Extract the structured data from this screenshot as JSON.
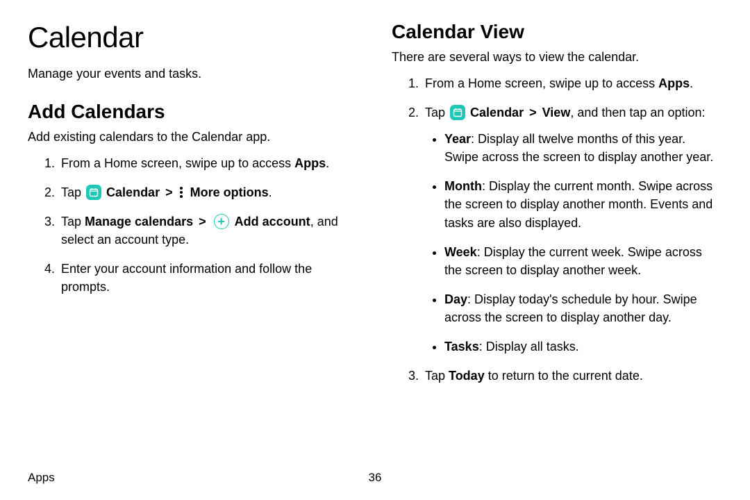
{
  "left": {
    "title": "Calendar",
    "subtitle": "Manage your events and tasks.",
    "section_heading": "Add Calendars",
    "section_intro": "Add existing calendars to the Calendar app.",
    "steps": {
      "s1_a": "From a Home screen, swipe up to access ",
      "s1_b": "Apps",
      "s1_c": ".",
      "s2_a": "Tap ",
      "s2_b": "Calendar",
      "s2_c": "More options",
      "s2_d": ".",
      "s3_a": "Tap ",
      "s3_b": "Manage calendars",
      "s3_c": "Add account",
      "s3_d": ", and select an account type.",
      "s4": "Enter your account information and follow the prompts."
    }
  },
  "right": {
    "section_heading": "Calendar View",
    "section_intro": "There are several ways to view the calendar.",
    "steps": {
      "s1_a": "From a Home screen, swipe up to access ",
      "s1_b": "Apps",
      "s1_c": ".",
      "s2_a": "Tap ",
      "s2_b": "Calendar",
      "s2_c": "View",
      "s2_d": ", and then tap an option:",
      "s3_a": "Tap ",
      "s3_b": "Today",
      "s3_c": " to return to the current date."
    },
    "bullets": {
      "b1_a": "Year",
      "b1_b": ": Display all twelve months of this year. Swipe across the screen to display another year.",
      "b2_a": "Month",
      "b2_b": ": Display the current month. Swipe across the screen to display another month. Events and tasks are also displayed.",
      "b3_a": "Week",
      "b3_b": ": Display the current week. Swipe across the screen to display another week.",
      "b4_a": "Day",
      "b4_b": ": Display today's schedule by hour. Swipe across the screen to display another day.",
      "b5_a": "Tasks",
      "b5_b": ": Display all tasks."
    }
  },
  "footer": {
    "label": "Apps",
    "page": "36"
  },
  "chevron": ">"
}
